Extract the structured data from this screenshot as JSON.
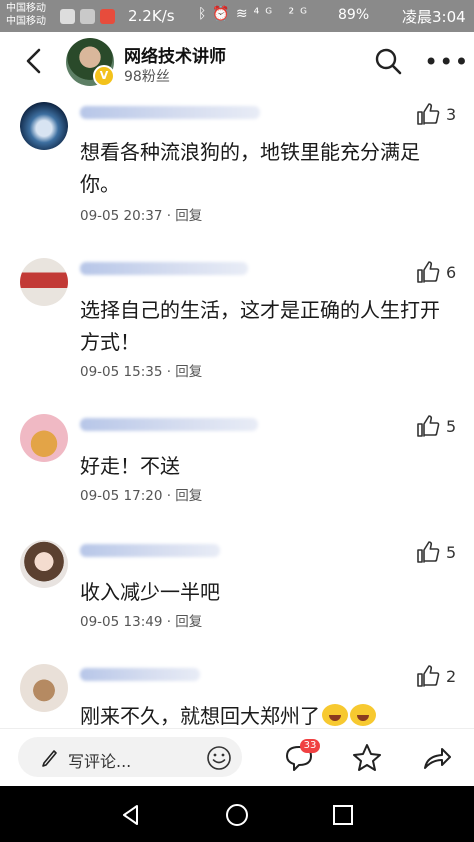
{
  "status_bar": {
    "carrier_1": "中国移动",
    "carrier_2": "中国移动",
    "speed": "2.2K/s",
    "signal": "⁴ᴳ ²ᴳ",
    "battery": "89%",
    "time": "凌晨3:04"
  },
  "header": {
    "author_name": "网络技术讲师",
    "fans": "98粉丝"
  },
  "comments": [
    {
      "likes": "3",
      "text": "想看各种流浪狗的，地铁里能充分满足你。",
      "meta": "09-05 20:37 · 回复"
    },
    {
      "likes": "6",
      "text": "选择自己的生活，这才是正确的人生打开方式！",
      "meta": "09-05 15:35 · 回复"
    },
    {
      "likes": "5",
      "text": "好走！不送",
      "meta": "09-05 17:20 · 回复"
    },
    {
      "likes": "5",
      "text": "收入减少一半吧",
      "meta": "09-05 13:49 · 回复"
    },
    {
      "likes": "2",
      "text": "刚来不久，就想回大郑州了",
      "meta": ""
    }
  ],
  "bottom_bar": {
    "comment_placeholder": "写评论...",
    "comment_badge": "33"
  },
  "colors": {
    "status_bar": "#8a8a8a",
    "badge": "#f04142",
    "verify": "#f3c21b",
    "nav_bar": "#000000"
  },
  "icons": [
    "back-icon",
    "search-icon",
    "more-icon",
    "thumbs-up-icon",
    "pen-icon",
    "emoji-icon",
    "comment-icon",
    "star-icon",
    "share-icon",
    "nav-back-icon",
    "nav-home-icon",
    "nav-recent-icon"
  ]
}
